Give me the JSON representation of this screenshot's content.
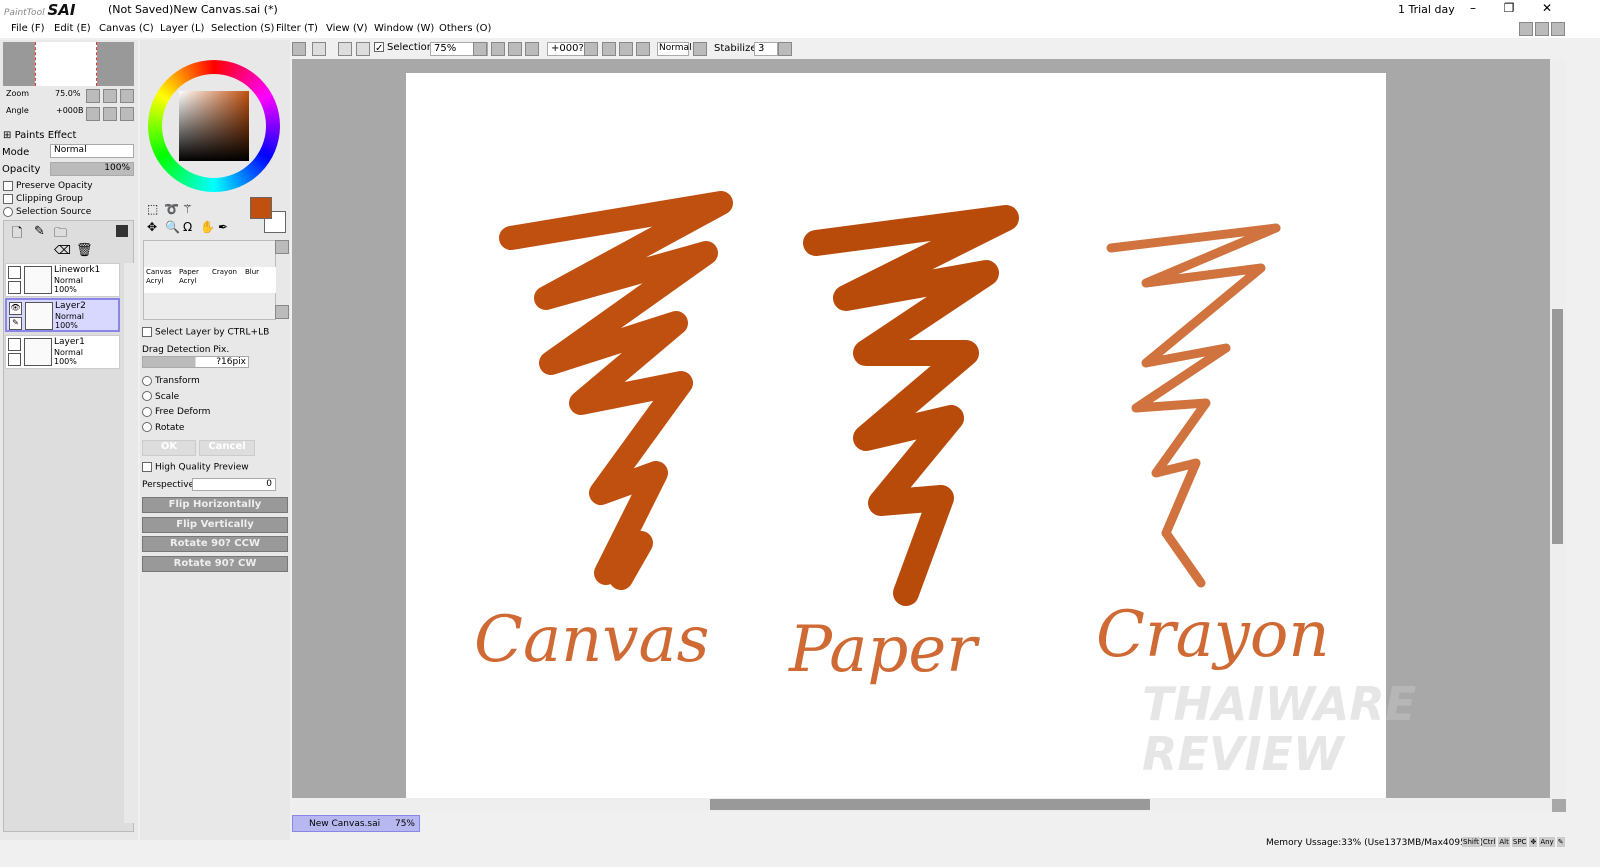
{
  "app": {
    "logo": "PaintTool SAI",
    "title": "(Not Saved)New Canvas.sai (*)",
    "trial": "1 Trial day"
  },
  "menu": [
    "File (F)",
    "Edit (E)",
    "Canvas (C)",
    "Layer (L)",
    "Selection (S)",
    "Filter (T)",
    "View (V)",
    "Window (W)",
    "Others (O)"
  ],
  "toolbar": {
    "selection_label": "Selection",
    "selection_checked": true,
    "zoom": "75%",
    "angle": "+000?",
    "blend": "Normal",
    "stabilizer_label": "Stabilizer",
    "stabilizer": "3"
  },
  "navigator": {
    "zoom_label": "Zoom",
    "zoom_value": "75.0%",
    "angle_label": "Angle",
    "angle_value": "+000B"
  },
  "layer_props": {
    "paints_effect": "Paints Effect",
    "mode_label": "Mode",
    "mode": "Normal",
    "opacity_label": "Opacity",
    "opacity": "100%",
    "preserve_opacity": "Preserve Opacity",
    "clipping_group": "Clipping Group",
    "selection_source": "Selection Source"
  },
  "layers": [
    {
      "name": "Linework1",
      "mode": "Normal",
      "opacity": "100%",
      "selected": false
    },
    {
      "name": "Layer2",
      "mode": "Normal",
      "opacity": "100%",
      "selected": true
    },
    {
      "name": "Layer1",
      "mode": "Normal",
      "opacity": "100%",
      "selected": false
    }
  ],
  "colors": {
    "primary": "#c0500f",
    "secondary": "#ffffff",
    "selected_layer": "#d8d8ff"
  },
  "tools": {
    "brushes": [
      {
        "l1": "Canvas",
        "l2": "Acryl"
      },
      {
        "l1": "Paper",
        "l2": "Acryl"
      },
      {
        "l1": "Crayon",
        "l2": ""
      },
      {
        "l1": "Blur",
        "l2": ""
      }
    ]
  },
  "transform": {
    "select_layer": "Select Layer by CTRL+LB",
    "drag_label": "Drag Detection Pix.",
    "drag_value": "?16pix",
    "options": [
      "Transform",
      "Scale",
      "Free Deform",
      "Rotate"
    ],
    "ok": "OK",
    "cancel": "Cancel",
    "hq_preview": "High Quality Preview",
    "perspective_label": "Perspective",
    "perspective": "0",
    "flip_h": "Flip Horizontally",
    "flip_v": "Flip Vertically",
    "rot_ccw": "Rotate 90? CCW",
    "rot_cw": "Rotate 90? CW"
  },
  "canvas": {
    "labels": [
      "Canvas",
      "Paper",
      "Crayon"
    ],
    "watermark": "THAIWARE REVIEW"
  },
  "doc_tab": {
    "name": "New Canvas.sai",
    "zoom": "75%"
  },
  "status": {
    "memory": "Memory Ussage:33% (Use1373MB/Max4095MB)",
    "keys": [
      "Shift",
      "Ctrl",
      "Alt",
      "SPC",
      "Any"
    ]
  }
}
